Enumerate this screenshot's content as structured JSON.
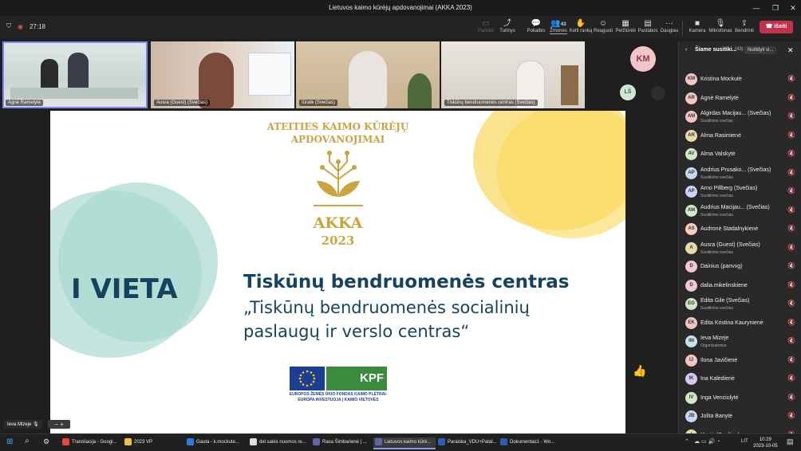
{
  "window": {
    "title": "Lietuvos kaimo kūrėjų apdovanojimai (AKKA 2023)"
  },
  "toolbar": {
    "timer": "27:18",
    "items": [
      {
        "label": "Parinkti",
        "icon": "screen-icon"
      },
      {
        "label": "Turinys",
        "icon": "share-icon"
      },
      {
        "label": "Pokalbis",
        "icon": "chat-icon"
      },
      {
        "label": "Žmonės",
        "icon": "people-icon",
        "count": "43"
      },
      {
        "label": "Kelti ranką",
        "icon": "hand-icon"
      },
      {
        "label": "Reaguoti",
        "icon": "smile-icon"
      },
      {
        "label": "Peržiūrėti",
        "icon": "view-icon"
      },
      {
        "label": "Pastabos",
        "icon": "notes-icon"
      },
      {
        "label": "Daugiau",
        "icon": "more-icon"
      },
      {
        "label": "Kamera",
        "icon": "camera-icon"
      },
      {
        "label": "Mikrofonas",
        "icon": "mic-off-icon"
      },
      {
        "label": "Bendrinti",
        "icon": "share-screen-icon"
      }
    ],
    "leave": "Išeiti"
  },
  "tiles": [
    {
      "name": "Agnė Ramelytė"
    },
    {
      "name": "Ausra (Guest) (Svečias)"
    },
    {
      "name": "Iūratė (Svečias)"
    },
    {
      "name": "Tiskūnų bendruomenės centras (Svečias)"
    }
  ],
  "gallery": {
    "avatar_large": "KM",
    "avatar_small": "LŠ"
  },
  "slide": {
    "heading_line1": "ATEITIES KAIMO KŪRĖJŲ",
    "heading_line2": "APDOVANOJIMAI",
    "logo_text": "AKKA",
    "logo_year": "2023",
    "place": "I VIETA",
    "organization": "Tiskūnų bendruomenės centras",
    "project_line1": "„Tiskūnų bendruomenės socialinių",
    "project_line2": "paslaugų ir verslo centras“",
    "kpf": "KPF",
    "caption_line1": "EUROPOS ŽEMĖS ŪKIO FONDAS KAIMO PLĖTRAI:",
    "caption_line2": "EUROPA INVESTUOJA Į KAIMO VIETOVES"
  },
  "panel": {
    "title": "Šiame susitiki...",
    "count": "(43)",
    "mute_all": "Nutildyti vi...",
    "participants": [
      {
        "initials": "KM",
        "name": "Kristina Mockutė",
        "role": "",
        "color": "#f3c5c5"
      },
      {
        "initials": "AR",
        "name": "Agnė Ramelytė",
        "role": "",
        "color": "#f3c5c5"
      },
      {
        "initials": "AM",
        "name": "Algirdas Macijau... (Svečias)",
        "role": "Susitikimo svečias",
        "color": "#f3c5c5"
      },
      {
        "initials": "AR",
        "name": "Alma Rasimienė",
        "role": "",
        "color": "#e8d9a8"
      },
      {
        "initials": "AV",
        "name": "Alma Valskytė",
        "role": "",
        "color": "#cfe8c7"
      },
      {
        "initials": "AP",
        "name": "Andrius Prusako... (Svečias)",
        "role": "Susitikimo svečias",
        "color": "#c7d7f3"
      },
      {
        "initials": "AP",
        "name": "Arno Pillberg (Svečias)",
        "role": "Susitikimo svečias",
        "color": "#c7d7f3"
      },
      {
        "initials": "AM",
        "name": "Audrius Macijau... (Svečias)",
        "role": "Susitikimo svečias",
        "color": "#cfe8c7"
      },
      {
        "initials": "AS",
        "name": "Audronė Stadalnykienė",
        "role": "",
        "color": "#f3d0c0"
      },
      {
        "initials": "A",
        "name": "Ausra (Guest) (Svečias)",
        "role": "Susitikimo svečias",
        "color": "#e8d9a8"
      },
      {
        "initials": "D",
        "name": "Dainius (panvvg)",
        "role": "",
        "color": "#f3c5d8"
      },
      {
        "initials": "D",
        "name": "dalia.mikelinskiene",
        "role": "",
        "color": "#f3c5d8"
      },
      {
        "initials": "EG",
        "name": "Edita Gile (Svečias)",
        "role": "Susitikimo svečias",
        "color": "#cfe8c7"
      },
      {
        "initials": "EK",
        "name": "Edita Kristina Kaurynienė",
        "role": "",
        "color": "#f3c5c5"
      },
      {
        "initials": "IM",
        "name": "Ieva Mizeje",
        "role": "Organizatorius",
        "color": "#c7e3e8"
      },
      {
        "initials": "IJ",
        "name": "Ilona Javičienė",
        "role": "",
        "color": "#f3c5c5"
      },
      {
        "initials": "IK",
        "name": "Ina Kalėdienė",
        "role": "",
        "color": "#d8c7f3"
      },
      {
        "initials": "IV",
        "name": "Inga Venciulytė",
        "role": "",
        "color": "#cfe8c7"
      },
      {
        "initials": "JB",
        "name": "Jolita Banytė",
        "role": "",
        "color": "#c7d7f3"
      },
      {
        "initials": "I",
        "name": "Iūratė (Svečias)",
        "role": "",
        "color": "#e8d9a8"
      }
    ]
  },
  "self_view": {
    "name": "Ieva Mizeje"
  },
  "taskbar": {
    "items": [
      {
        "label": "Transliacija - Googl...",
        "color": "#e8453c"
      },
      {
        "label": "2023 VP",
        "color": "#f0c040"
      },
      {
        "label": "Gauta - k.mockute...",
        "color": "#2f7ad8"
      },
      {
        "label": "del salės nuomos re...",
        "color": "#dddddd"
      },
      {
        "label": "Rasa Šimbarienė | ...",
        "color": "#6264a7"
      },
      {
        "label": "Lietuvos kaimo kūrė...",
        "color": "#6264a7"
      },
      {
        "label": "Paraiska_VDU+Patal...",
        "color": "#2b5fb4"
      },
      {
        "label": "Dokumentas1 - Wo...",
        "color": "#2b5fb4"
      }
    ],
    "tray": "LIT",
    "time": "10:29",
    "date": "2023-10-05"
  }
}
